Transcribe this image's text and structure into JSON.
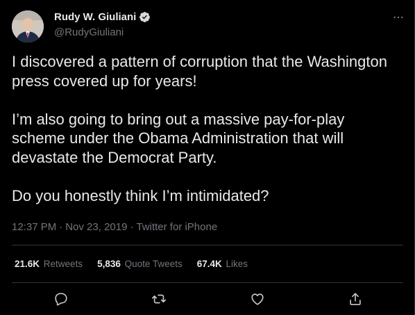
{
  "author": {
    "name": "Rudy W. Giuliani",
    "handle": "@RudyGiuliani",
    "verified": true,
    "avatar_icon": "profile-photo"
  },
  "tweet": {
    "paragraphs": [
      "I discovered a pattern of corruption that the Washington press covered up for years!",
      "I’m also going to bring out a massive pay-for-play scheme under the Obama Administration that will devastate the Democrat Party.",
      "Do you honestly think I’m intimidated?"
    ]
  },
  "meta": {
    "time": "12:37 PM",
    "date": "Nov 23, 2019",
    "source": "Twitter for iPhone",
    "separator": "·"
  },
  "stats": {
    "retweets": {
      "count": "21.6K",
      "label": "Retweets"
    },
    "quotes": {
      "count": "5,836",
      "label": "Quote Tweets"
    },
    "likes": {
      "count": "67.4K",
      "label": "Likes"
    }
  },
  "actions": [
    "reply-icon",
    "retweet-icon",
    "like-icon",
    "share-icon"
  ],
  "colors": {
    "background": "#000000",
    "text": "#e7e9ea",
    "secondary": "#71767b",
    "divider": "#2f3336",
    "verified": "#d9d9d9"
  }
}
